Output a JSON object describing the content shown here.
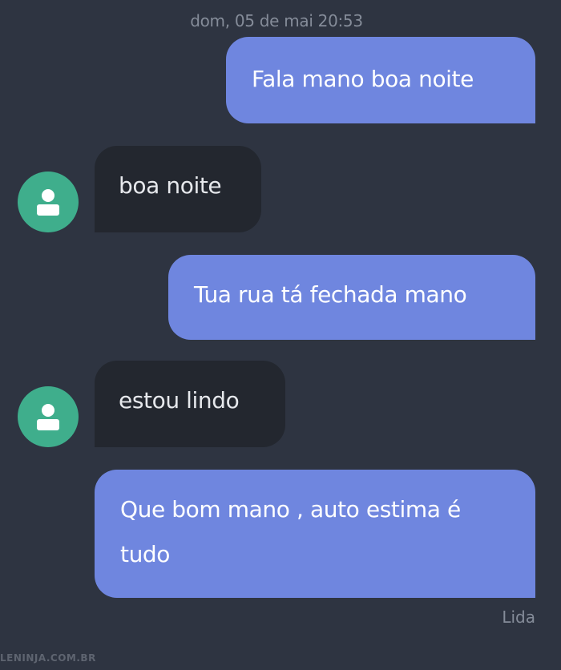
{
  "header": {
    "timestamp": "dom, 05 de mai 20:53"
  },
  "messages": [
    {
      "direction": "sent",
      "text": "Fala mano boa noite"
    },
    {
      "direction": "received",
      "text": "boa noite",
      "avatar_icon": "user-icon"
    },
    {
      "direction": "sent",
      "text": "Tua rua tá fechada mano"
    },
    {
      "direction": "received",
      "text": "estou lindo",
      "avatar_icon": "user-icon"
    },
    {
      "direction": "sent",
      "text": "Que bom mano , auto estima é tudo"
    }
  ],
  "footer": {
    "read_status": "Lida",
    "watermark": "LENINJA.COM.BR"
  },
  "colors": {
    "background": "#2e3441",
    "sent_bubble": "#6f86df",
    "received_bubble": "#23272f",
    "avatar": "#3fae8c"
  }
}
